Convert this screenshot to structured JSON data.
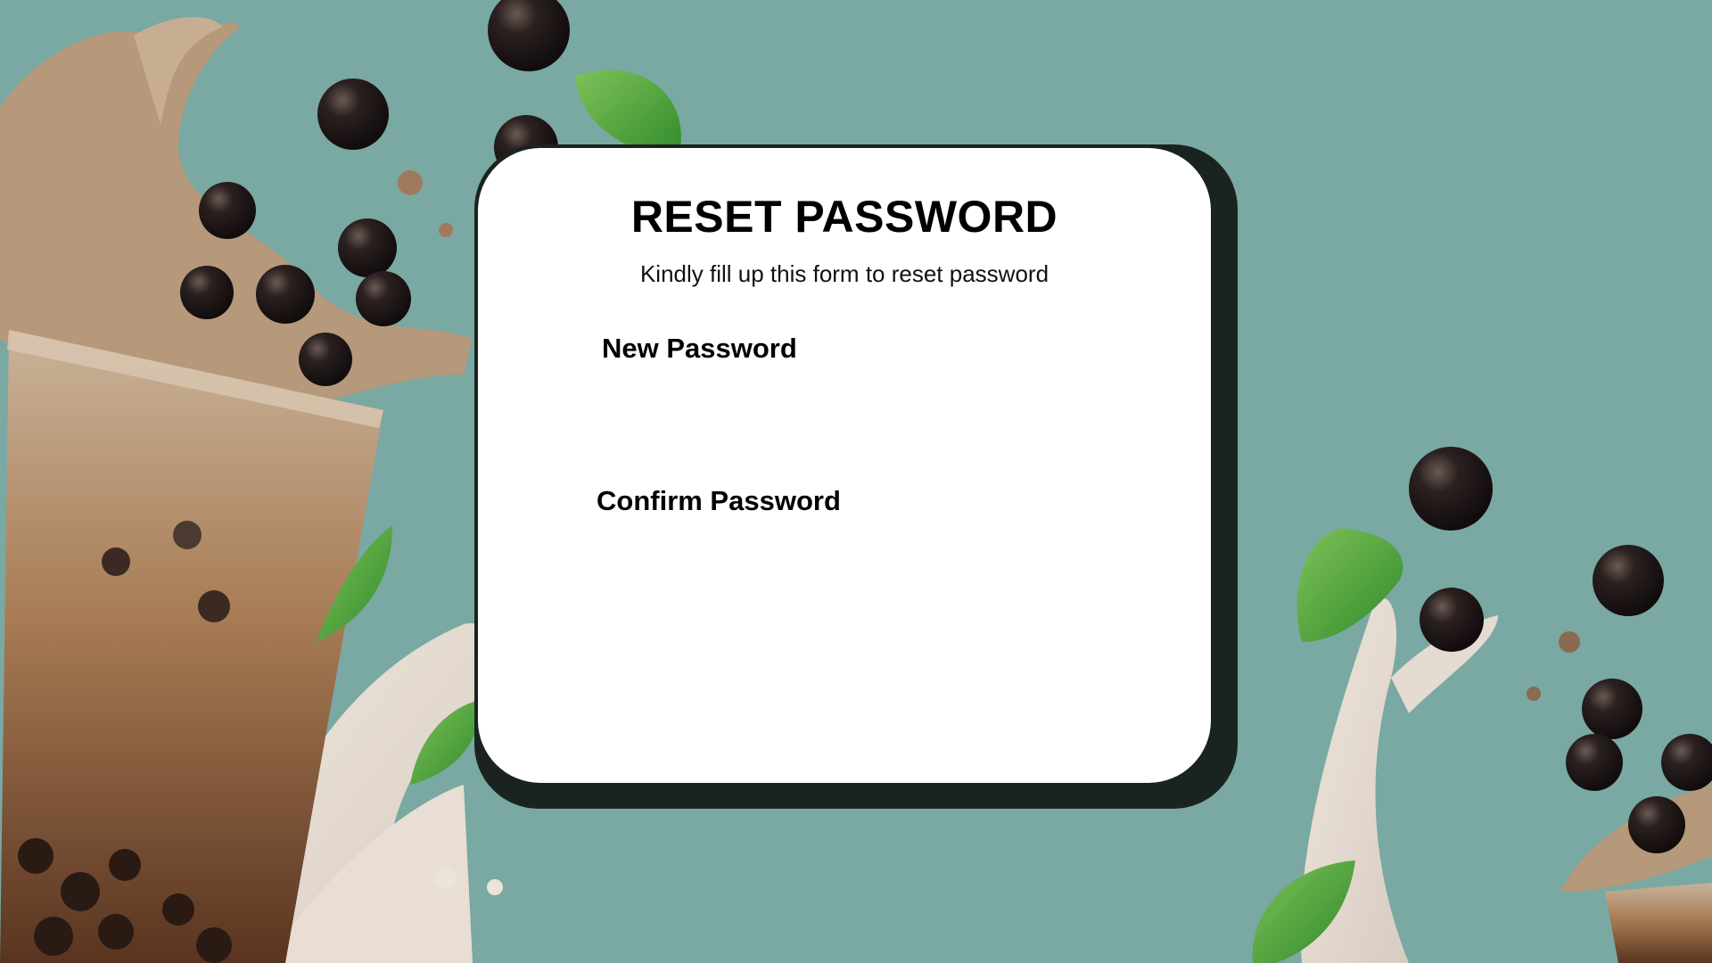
{
  "form": {
    "title": "RESET PASSWORD",
    "subtitle": "Kindly fill up this form to reset password",
    "new_password_label": "New Password",
    "new_password_value": "",
    "confirm_password_label": "Confirm Password",
    "confirm_password_value": ""
  },
  "colors": {
    "background": "#7aa8a2",
    "card": "#ffffff",
    "card_shadow": "#1b2321"
  }
}
